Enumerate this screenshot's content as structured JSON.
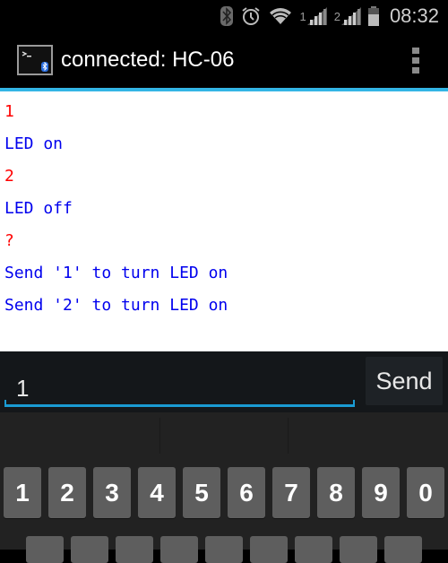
{
  "status_bar": {
    "icons": [
      "bluetooth-icon",
      "alarm-icon",
      "wifi-icon",
      "signal-sim1-icon",
      "signal-sim2-icon",
      "battery-icon"
    ],
    "sim1_label": "1",
    "sim2_label": "2",
    "time": "08:32"
  },
  "action_bar": {
    "app_icon": "terminal-bluetooth-icon",
    "title": "connected: HC-06",
    "overflow_icon": "overflow-menu-icon"
  },
  "terminal": {
    "lines": [
      {
        "text": "1",
        "type": "sent",
        "color": "#ff0000"
      },
      {
        "text": "LED on",
        "type": "received",
        "color": "#0000ee"
      },
      {
        "text": "2",
        "type": "sent",
        "color": "#ff0000"
      },
      {
        "text": "LED off",
        "type": "received",
        "color": "#0000ee"
      },
      {
        "text": "?",
        "type": "sent",
        "color": "#ff0000"
      },
      {
        "text": "Send '1' to turn LED on",
        "type": "received",
        "color": "#0000ee"
      },
      {
        "text": "Send '2' to turn LED on",
        "type": "received",
        "color": "#0000ee"
      }
    ]
  },
  "input": {
    "value": "1",
    "send_label": "Send"
  },
  "keyboard": {
    "number_row": [
      "1",
      "2",
      "3",
      "4",
      "5",
      "6",
      "7",
      "8",
      "9",
      "0"
    ]
  },
  "colors": {
    "accent": "#33b5e5",
    "sent_text": "#ff0000",
    "received_text": "#0000ee"
  }
}
